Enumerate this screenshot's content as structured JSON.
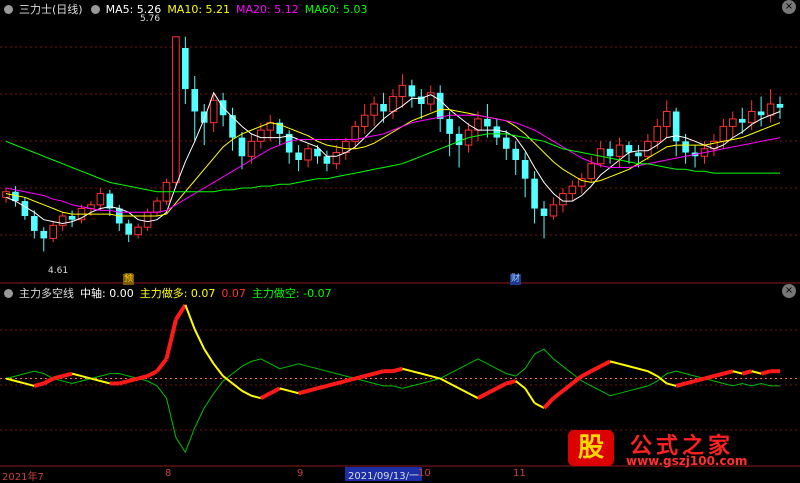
{
  "header": {
    "title": "三力士(日线)",
    "ma5": "MA5: 5.26",
    "ma10": "MA10: 5.21",
    "ma20": "MA20: 5.12",
    "ma60": "MA60: 5.03",
    "colors": {
      "ma5": "#ffffff",
      "ma10": "#ffff00",
      "ma20": "#ff00ff",
      "ma60": "#00ff00"
    }
  },
  "price_panel": {
    "high_label": "5.76",
    "low_label": "4.61"
  },
  "indicator": {
    "name": "主力多空线",
    "middle": "中轴: 0.00",
    "long_label": "主力做多: 0.07",
    "val_red": "0.07",
    "short_label": "主力做空: -0.07"
  },
  "events": {
    "first": "预",
    "second": "财"
  },
  "xaxis": {
    "labels": [
      "2021年7",
      "8",
      "9",
      "10",
      "11"
    ],
    "cursor": "2021/09/13/一"
  },
  "watermark": {
    "glyph": "股",
    "name": "公式之家",
    "url": "www.gszj100.com"
  },
  "chart_data": {
    "type": "candlestick",
    "price_range": [
      4.5,
      5.85
    ],
    "candles": [
      [
        4.9,
        4.93,
        4.87,
        4.95
      ],
      [
        4.93,
        4.88,
        4.85,
        4.96
      ],
      [
        4.88,
        4.8,
        4.78,
        4.9
      ],
      [
        4.8,
        4.72,
        4.68,
        4.83
      ],
      [
        4.72,
        4.68,
        4.61,
        4.74
      ],
      [
        4.68,
        4.75,
        4.66,
        4.77
      ],
      [
        4.75,
        4.8,
        4.72,
        4.82
      ],
      [
        4.8,
        4.78,
        4.74,
        4.83
      ],
      [
        4.78,
        4.84,
        4.76,
        4.86
      ],
      [
        4.84,
        4.86,
        4.8,
        4.88
      ],
      [
        4.86,
        4.92,
        4.83,
        4.95
      ],
      [
        4.92,
        4.84,
        4.8,
        4.94
      ],
      [
        4.84,
        4.76,
        4.72,
        4.86
      ],
      [
        4.76,
        4.7,
        4.66,
        4.78
      ],
      [
        4.7,
        4.74,
        4.68,
        4.76
      ],
      [
        4.74,
        4.82,
        4.72,
        4.84
      ],
      [
        4.82,
        4.88,
        4.8,
        4.9
      ],
      [
        4.88,
        4.98,
        4.86,
        5.0
      ],
      [
        4.98,
        5.76,
        4.96,
        5.76
      ],
      [
        5.7,
        5.48,
        5.4,
        5.76
      ],
      [
        5.48,
        5.36,
        5.2,
        5.55
      ],
      [
        5.36,
        5.3,
        5.18,
        5.4
      ],
      [
        5.3,
        5.42,
        5.25,
        5.45
      ],
      [
        5.42,
        5.34,
        5.28,
        5.46
      ],
      [
        5.34,
        5.22,
        5.15,
        5.38
      ],
      [
        5.22,
        5.12,
        5.05,
        5.25
      ],
      [
        5.12,
        5.2,
        5.08,
        5.24
      ],
      [
        5.2,
        5.26,
        5.16,
        5.3
      ],
      [
        5.26,
        5.3,
        5.2,
        5.34
      ],
      [
        5.3,
        5.24,
        5.18,
        5.32
      ],
      [
        5.24,
        5.14,
        5.08,
        5.26
      ],
      [
        5.14,
        5.1,
        5.04,
        5.18
      ],
      [
        5.1,
        5.16,
        5.06,
        5.19
      ],
      [
        5.16,
        5.12,
        5.08,
        5.18
      ],
      [
        5.12,
        5.08,
        5.04,
        5.15
      ],
      [
        5.08,
        5.14,
        5.05,
        5.18
      ],
      [
        5.14,
        5.2,
        5.1,
        5.22
      ],
      [
        5.2,
        5.28,
        5.16,
        5.31
      ],
      [
        5.28,
        5.34,
        5.24,
        5.4
      ],
      [
        5.34,
        5.4,
        5.28,
        5.44
      ],
      [
        5.4,
        5.36,
        5.3,
        5.46
      ],
      [
        5.36,
        5.44,
        5.32,
        5.48
      ],
      [
        5.44,
        5.5,
        5.38,
        5.56
      ],
      [
        5.5,
        5.44,
        5.38,
        5.53
      ],
      [
        5.44,
        5.4,
        5.32,
        5.48
      ],
      [
        5.4,
        5.46,
        5.36,
        5.5
      ],
      [
        5.46,
        5.32,
        5.25,
        5.5
      ],
      [
        5.32,
        5.24,
        5.12,
        5.36
      ],
      [
        5.24,
        5.18,
        5.06,
        5.28
      ],
      [
        5.18,
        5.26,
        5.14,
        5.3
      ],
      [
        5.26,
        5.32,
        5.2,
        5.36
      ],
      [
        5.32,
        5.28,
        5.22,
        5.4
      ],
      [
        5.28,
        5.22,
        5.18,
        5.32
      ],
      [
        5.22,
        5.16,
        5.1,
        5.26
      ],
      [
        5.16,
        5.1,
        5.02,
        5.2
      ],
      [
        5.1,
        5.0,
        4.9,
        5.14
      ],
      [
        5.0,
        4.84,
        4.76,
        5.04
      ],
      [
        4.84,
        4.8,
        4.68,
        4.88
      ],
      [
        4.8,
        4.86,
        4.78,
        4.9
      ],
      [
        4.86,
        4.92,
        4.82,
        4.95
      ],
      [
        4.92,
        4.96,
        4.88,
        4.99
      ],
      [
        4.96,
        5.0,
        4.92,
        5.03
      ],
      [
        5.0,
        5.08,
        4.98,
        5.12
      ],
      [
        5.08,
        5.16,
        5.06,
        5.2
      ],
      [
        5.16,
        5.12,
        5.08,
        5.2
      ],
      [
        5.12,
        5.18,
        5.06,
        5.22
      ],
      [
        5.18,
        5.14,
        5.08,
        5.2
      ],
      [
        5.14,
        5.12,
        5.06,
        5.18
      ],
      [
        5.12,
        5.2,
        5.1,
        5.24
      ],
      [
        5.2,
        5.28,
        5.16,
        5.32
      ],
      [
        5.28,
        5.36,
        5.22,
        5.42
      ],
      [
        5.36,
        5.2,
        5.12,
        5.38
      ],
      [
        5.2,
        5.14,
        5.08,
        5.24
      ],
      [
        5.14,
        5.12,
        5.06,
        5.18
      ],
      [
        5.12,
        5.16,
        5.08,
        5.2
      ],
      [
        5.16,
        5.2,
        5.12,
        5.24
      ],
      [
        5.2,
        5.28,
        5.16,
        5.32
      ],
      [
        5.28,
        5.32,
        5.22,
        5.36
      ],
      [
        5.32,
        5.3,
        5.24,
        5.38
      ],
      [
        5.3,
        5.36,
        5.26,
        5.42
      ],
      [
        5.36,
        5.34,
        5.28,
        5.44
      ],
      [
        5.34,
        5.4,
        5.3,
        5.48
      ],
      [
        5.4,
        5.38,
        5.32,
        5.44
      ]
    ],
    "ma_lines": {
      "ma5": [
        4.9,
        4.88,
        4.85,
        4.82,
        4.78,
        4.77,
        4.76,
        4.77,
        4.79,
        4.82,
        4.84,
        4.85,
        4.84,
        4.82,
        4.78,
        4.77,
        4.78,
        4.82,
        4.96,
        5.09,
        5.2,
        5.32,
        5.46,
        5.38,
        5.33,
        5.28,
        5.24,
        5.22,
        5.22,
        5.22,
        5.23,
        5.21,
        5.19,
        5.17,
        5.12,
        5.12,
        5.14,
        5.17,
        5.22,
        5.27,
        5.32,
        5.36,
        5.39,
        5.43,
        5.43,
        5.45,
        5.42,
        5.37,
        5.33,
        5.29,
        5.26,
        5.26,
        5.26,
        5.25,
        5.22,
        5.15,
        5.06,
        4.98,
        4.92,
        4.88,
        4.88,
        4.91,
        4.96,
        5.02,
        5.06,
        5.1,
        5.14,
        5.15,
        5.15,
        5.18,
        5.22,
        5.23,
        5.22,
        5.2,
        5.18,
        5.16,
        5.18,
        5.22,
        5.25,
        5.29,
        5.32,
        5.34,
        5.36
      ],
      "ma10": [
        4.92,
        4.91,
        4.9,
        4.88,
        4.86,
        4.84,
        4.82,
        4.81,
        4.81,
        4.81,
        4.81,
        4.81,
        4.8,
        4.8,
        4.8,
        4.8,
        4.8,
        4.81,
        4.87,
        4.93,
        4.99,
        5.05,
        5.11,
        5.17,
        5.21,
        5.24,
        5.26,
        5.28,
        5.3,
        5.29,
        5.27,
        5.25,
        5.23,
        5.2,
        5.18,
        5.17,
        5.16,
        5.16,
        5.17,
        5.19,
        5.22,
        5.25,
        5.28,
        5.31,
        5.33,
        5.35,
        5.37,
        5.37,
        5.36,
        5.35,
        5.34,
        5.33,
        5.32,
        5.31,
        5.28,
        5.24,
        5.19,
        5.14,
        5.09,
        5.05,
        5.02,
        4.99,
        4.98,
        4.99,
        5.01,
        5.03,
        5.05,
        5.08,
        5.11,
        5.14,
        5.17,
        5.18,
        5.18,
        5.18,
        5.18,
        5.19,
        5.2,
        5.21,
        5.22,
        5.24,
        5.26,
        5.28,
        5.3
      ],
      "ma20": [
        4.95,
        4.94,
        4.93,
        4.92,
        4.91,
        4.89,
        4.88,
        4.86,
        4.85,
        4.84,
        4.83,
        4.83,
        4.82,
        4.82,
        4.82,
        4.82,
        4.82,
        4.83,
        4.86,
        4.89,
        4.92,
        4.95,
        4.98,
        5.01,
        5.04,
        5.07,
        5.1,
        5.13,
        5.16,
        5.18,
        5.2,
        5.21,
        5.21,
        5.21,
        5.21,
        5.21,
        5.21,
        5.21,
        5.22,
        5.23,
        5.24,
        5.26,
        5.28,
        5.3,
        5.31,
        5.32,
        5.33,
        5.34,
        5.34,
        5.34,
        5.34,
        5.33,
        5.32,
        5.31,
        5.3,
        5.28,
        5.26,
        5.23,
        5.2,
        5.17,
        5.14,
        5.11,
        5.09,
        5.07,
        5.06,
        5.06,
        5.06,
        5.07,
        5.08,
        5.09,
        5.1,
        5.11,
        5.12,
        5.13,
        5.14,
        5.15,
        5.16,
        5.17,
        5.18,
        5.19,
        5.2,
        5.21,
        5.22
      ],
      "ma60": [
        5.2,
        5.18,
        5.16,
        5.14,
        5.12,
        5.1,
        5.08,
        5.06,
        5.04,
        5.02,
        5.0,
        4.98,
        4.97,
        4.96,
        4.95,
        4.94,
        4.93,
        4.93,
        4.93,
        4.93,
        4.93,
        4.93,
        4.93,
        4.94,
        4.94,
        4.95,
        4.95,
        4.96,
        4.96,
        4.97,
        4.97,
        4.98,
        4.99,
        5.0,
        5.0,
        5.01,
        5.02,
        5.03,
        5.04,
        5.05,
        5.06,
        5.07,
        5.08,
        5.1,
        5.12,
        5.14,
        5.16,
        5.18,
        5.2,
        5.22,
        5.23,
        5.24,
        5.24,
        5.24,
        5.23,
        5.22,
        5.21,
        5.2,
        5.18,
        5.16,
        5.15,
        5.14,
        5.13,
        5.12,
        5.11,
        5.1,
        5.09,
        5.08,
        5.08,
        5.07,
        5.06,
        5.05,
        5.05,
        5.04,
        5.04,
        5.03,
        5.03,
        5.03,
        5.03,
        5.03,
        5.03,
        5.03,
        5.03
      ]
    },
    "indicator_range": [
      -0.34,
      0.32
    ],
    "indicator_line": [
      0.0,
      -0.01,
      -0.02,
      -0.03,
      -0.02,
      0.0,
      0.01,
      0.02,
      0.01,
      0.0,
      -0.01,
      -0.02,
      -0.02,
      -0.01,
      0.0,
      0.01,
      0.03,
      0.08,
      0.24,
      0.3,
      0.2,
      0.12,
      0.06,
      0.01,
      -0.02,
      -0.05,
      -0.07,
      -0.08,
      -0.06,
      -0.04,
      -0.05,
      -0.06,
      -0.05,
      -0.04,
      -0.03,
      -0.02,
      -0.01,
      0.0,
      0.01,
      0.02,
      0.03,
      0.03,
      0.04,
      0.03,
      0.02,
      0.01,
      0.0,
      -0.02,
      -0.04,
      -0.06,
      -0.08,
      -0.06,
      -0.04,
      -0.02,
      -0.01,
      -0.04,
      -0.1,
      -0.12,
      -0.08,
      -0.05,
      -0.02,
      0.01,
      0.03,
      0.05,
      0.07,
      0.06,
      0.05,
      0.04,
      0.03,
      0.01,
      -0.02,
      -0.03,
      -0.02,
      -0.01,
      0.0,
      0.01,
      0.02,
      0.03,
      0.02,
      0.03,
      0.02,
      0.03,
      0.03
    ]
  }
}
